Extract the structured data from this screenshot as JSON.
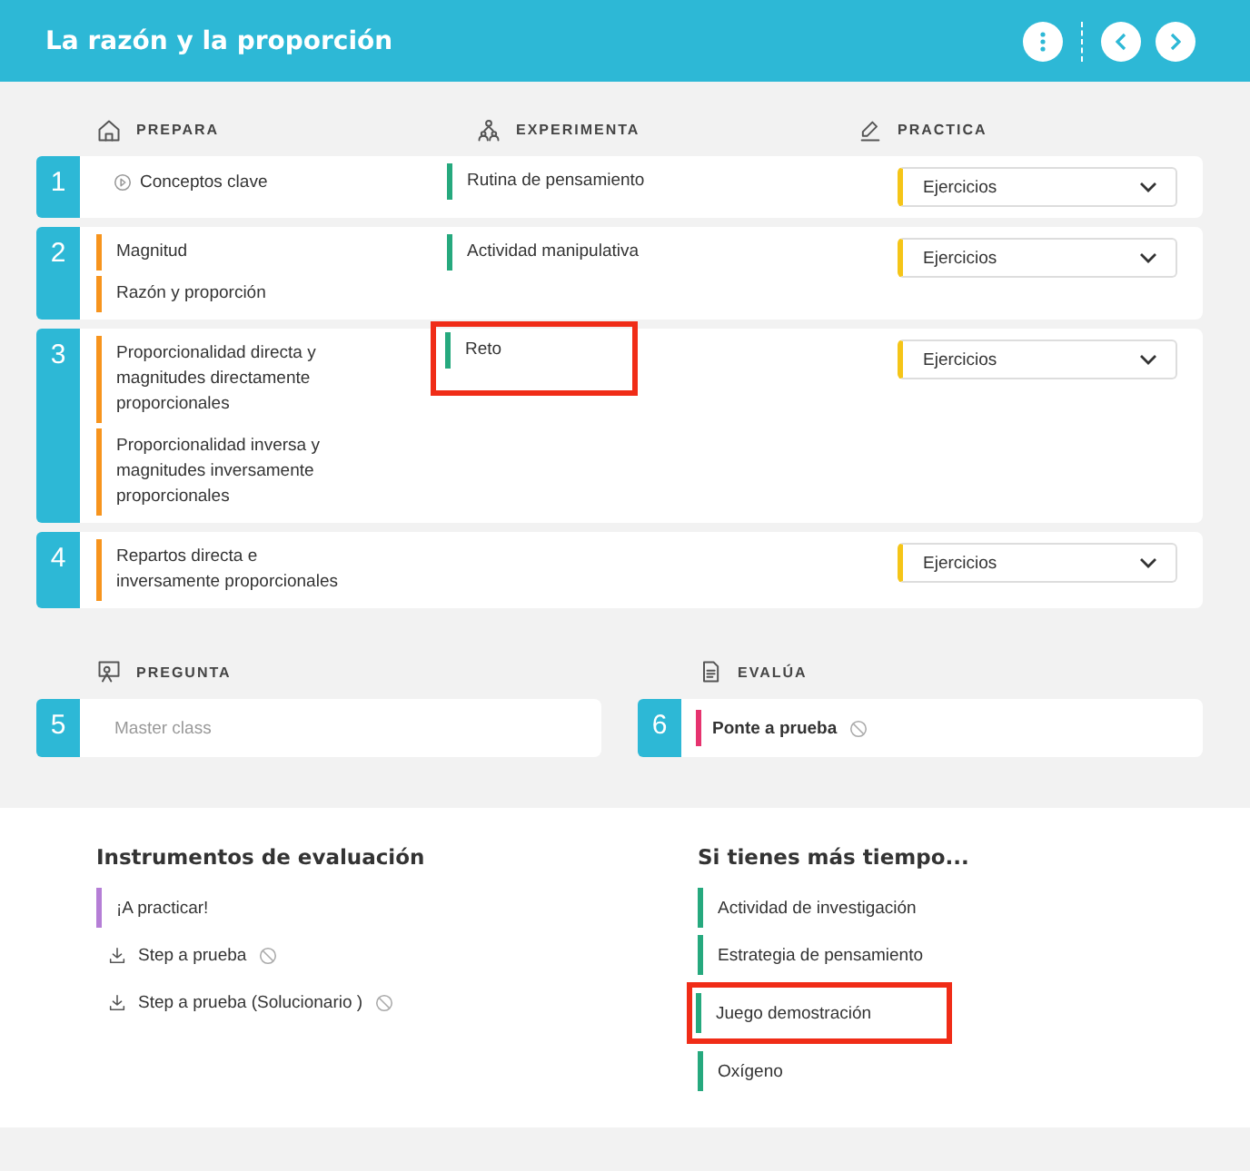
{
  "header": {
    "title": "La razón y la proporción"
  },
  "columns": [
    {
      "kind": "home",
      "label": "PREPARA"
    },
    {
      "kind": "people",
      "label": "EXPERIMENTA"
    },
    {
      "kind": "pencil",
      "label": "PRACTICA"
    }
  ],
  "rows": [
    {
      "number": "1",
      "prepara": [
        {
          "kind": "video",
          "label": "Conceptos clave"
        }
      ],
      "experimenta": [
        {
          "label": "Rutina de pensamiento",
          "highlighted": false
        }
      ],
      "practica": {
        "value": "Ejercicios"
      }
    },
    {
      "number": "2",
      "prepara": [
        {
          "kind": "topic",
          "label": "Magnitud"
        },
        {
          "kind": "topic",
          "label": "Razón y proporción"
        }
      ],
      "experimenta": [
        {
          "label": "Actividad manipulativa",
          "highlighted": false
        }
      ],
      "practica": {
        "value": "Ejercicios"
      }
    },
    {
      "number": "3",
      "prepara": [
        {
          "kind": "topic",
          "label": "Proporcionalidad directa y magnitudes directamente proporcionales"
        },
        {
          "kind": "topic",
          "label": "Proporcionalidad inversa y magnitudes inversamente proporcionales"
        }
      ],
      "experimenta": [
        {
          "label": "Reto",
          "highlighted": true
        }
      ],
      "practica": {
        "value": "Ejercicios"
      }
    },
    {
      "number": "4",
      "prepara": [
        {
          "kind": "topic",
          "label": "Repartos directa e inversamente proporcionales"
        }
      ],
      "experimenta": [],
      "practica": {
        "value": "Ejercicios"
      }
    }
  ],
  "sections": [
    {
      "kind": "pregunta",
      "label": "PREGUNTA",
      "number": "5",
      "item": {
        "label": "Master class",
        "disabled": true,
        "color": "#ffffff"
      }
    },
    {
      "kind": "evalua",
      "label": "EVALÚA",
      "number": "6",
      "item": {
        "label": "Ponte a prueba",
        "disabled": false,
        "blocked": true,
        "color": "#e6336f"
      }
    }
  ],
  "instruments": {
    "title": "Instrumentos de evaluación",
    "items": [
      {
        "kind": "activity",
        "label": "¡A practicar!"
      },
      {
        "kind": "download",
        "label": "Step a prueba",
        "blocked": true
      },
      {
        "kind": "download",
        "label": "Step a prueba (Solucionario )",
        "blocked": true
      }
    ]
  },
  "extra": {
    "title": "Si tienes más tiempo...",
    "items": [
      {
        "label": "Actividad de investigación",
        "highlighted": false
      },
      {
        "label": "Estrategia de pensamiento",
        "highlighted": false
      },
      {
        "label": "Juego demostración",
        "highlighted": true
      },
      {
        "label": "Oxígeno",
        "highlighted": false
      }
    ]
  }
}
